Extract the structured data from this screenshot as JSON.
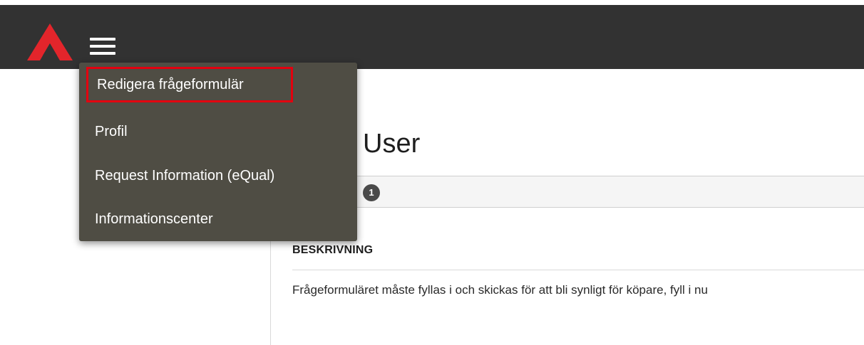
{
  "header": {
    "logo_icon": "brand-logo-triangle",
    "menu_icon": "hamburger-menu-icon",
    "brand_color": "#e3252b",
    "bar_color": "#323232"
  },
  "dropdown": {
    "items": [
      {
        "label": "Redigera frågeformulär",
        "highlighted": true
      },
      {
        "label": "Profil"
      },
      {
        "label": "Request Information (eQual)"
      },
      {
        "label": "Informationscenter"
      }
    ],
    "highlight_color": "#e3000f"
  },
  "main": {
    "title": "User",
    "tab_badge": "1",
    "section_heading": "BESKRIVNING",
    "section_body": "Frågeformuläret måste fyllas i och skickas för att bli synligt för köpare, fyll i nu"
  }
}
